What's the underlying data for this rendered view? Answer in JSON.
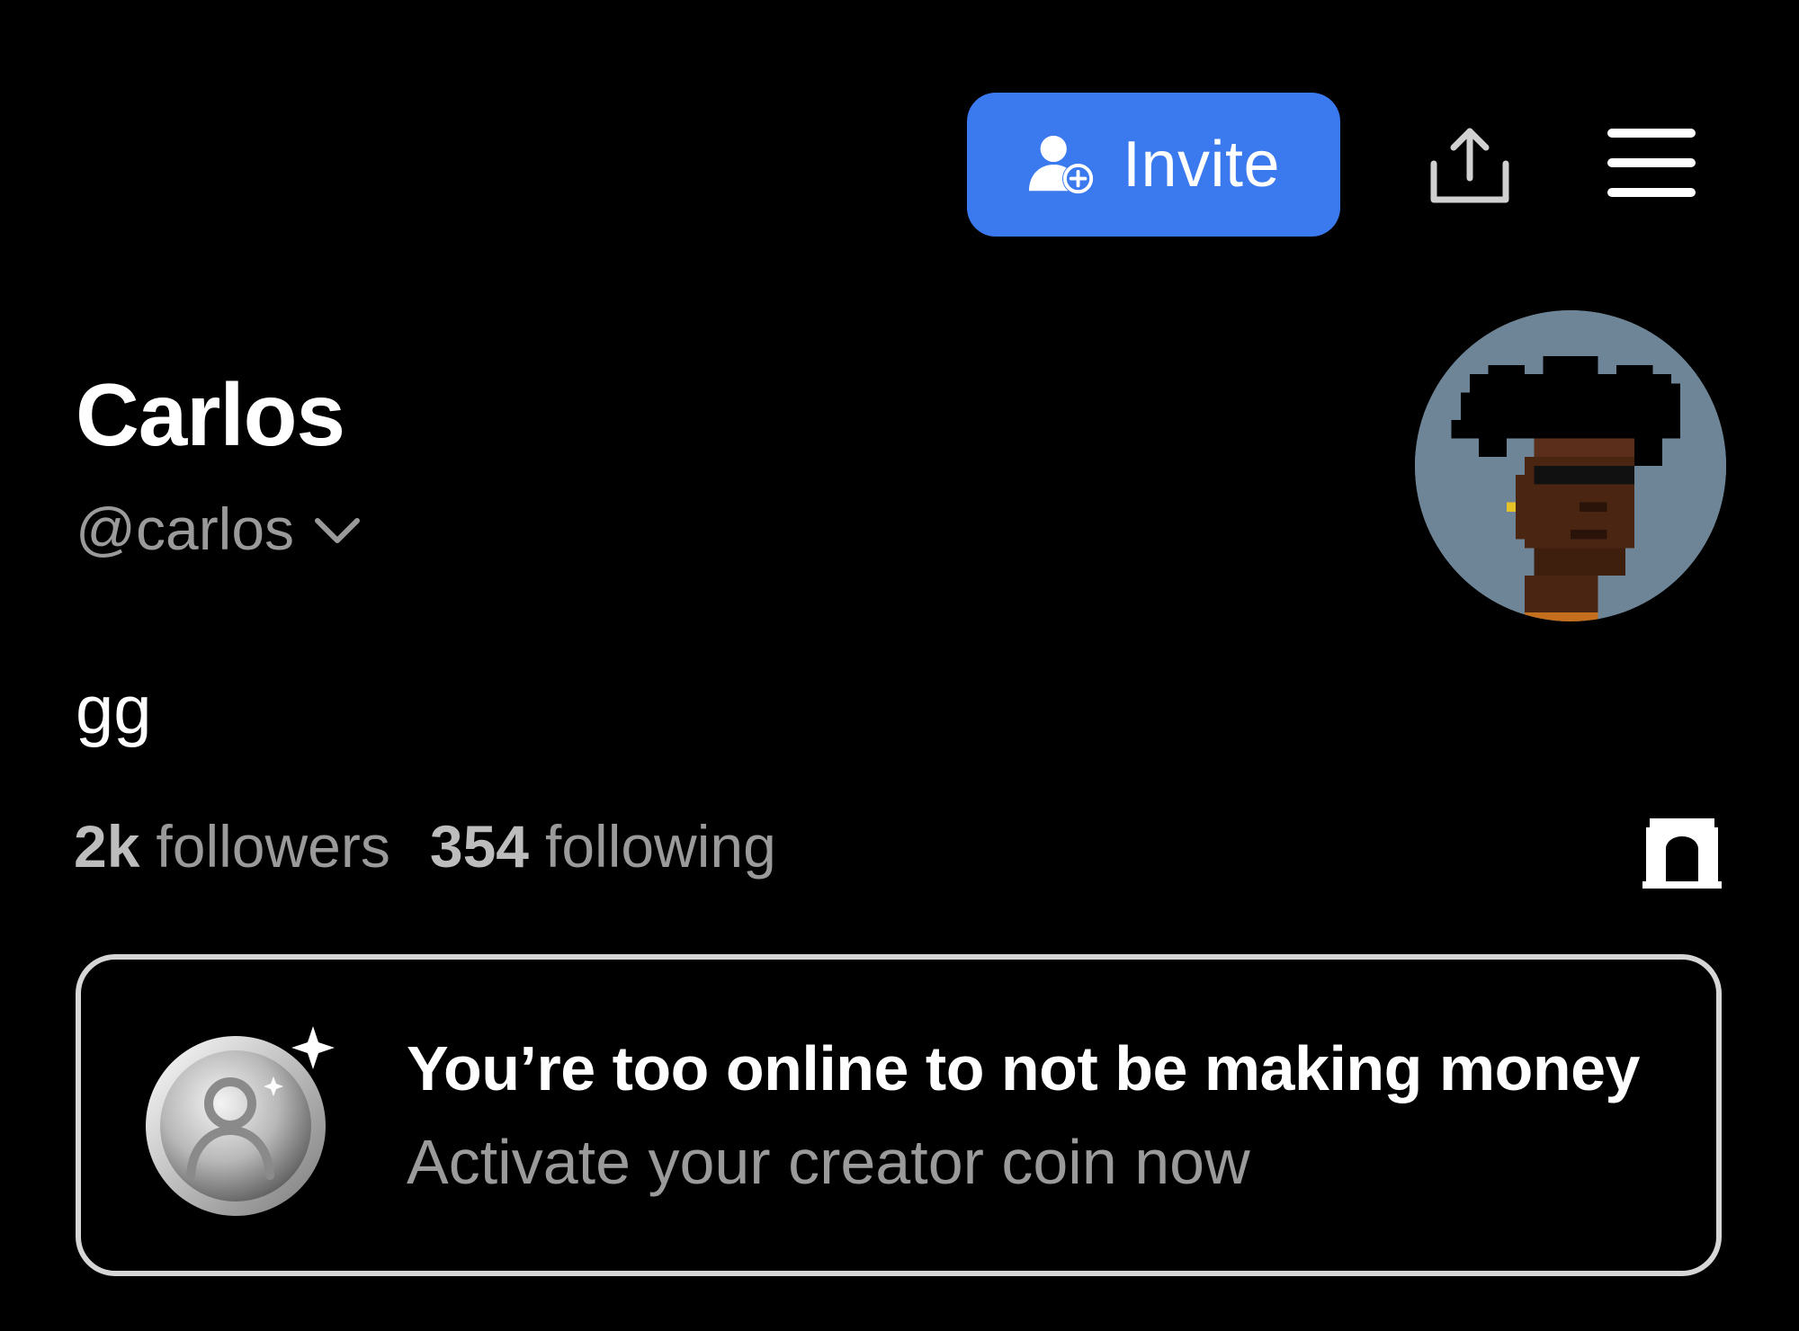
{
  "header": {
    "invite_label": "Invite",
    "invite_color": "#3a79ee",
    "invite_icon": "add-user-icon",
    "share_icon": "share-upload-icon",
    "menu_icon": "hamburger-menu-icon"
  },
  "profile": {
    "display_name": "Carlos",
    "handle": "@carlos",
    "handle_icon": "chevron-down-icon",
    "bio": "gg",
    "avatar": "pixel-art-avatar",
    "followers_count": "2k",
    "followers_label": "followers",
    "following_count": "354",
    "following_label": "following",
    "badge_icon": "arch-icon"
  },
  "promo": {
    "title": "You’re too online to not be making money",
    "subtitle": "Activate your creator coin now",
    "coin_icon": "silver-coin-icon"
  },
  "colors": {
    "background": "#000000",
    "text_primary": "#ffffff",
    "text_secondary": "#9a9a9a",
    "card_border": "#d6d6d6",
    "avatar_bg": "#6e8597"
  }
}
